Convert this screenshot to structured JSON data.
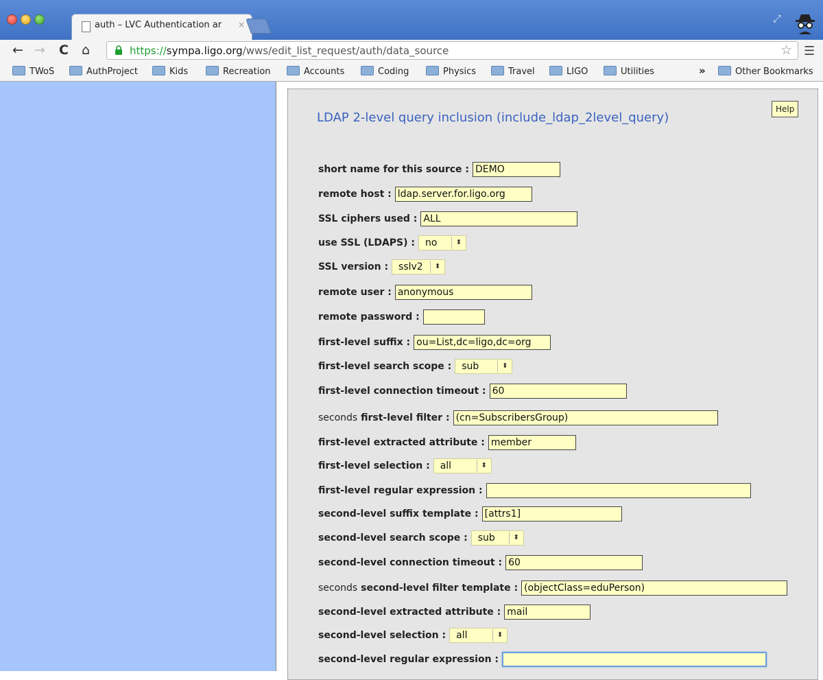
{
  "browser": {
    "tab_title": "auth – LVC Authentication ar",
    "tab_close": "×",
    "url_scheme": "https://",
    "url_host": "sympa.ligo.org",
    "url_path": "/wws/edit_list_request/auth/data_source",
    "nav": {
      "back": "←",
      "forward": "→",
      "reload": "C",
      "home": "⌂",
      "menu": "☰",
      "star": "☆"
    }
  },
  "bookmarks": {
    "items": [
      "TWoS",
      "AuthProject",
      "Kids",
      "Recreation",
      "Accounts",
      "Coding",
      "Physics",
      "Travel",
      "LIGO",
      "Utilities"
    ],
    "more": "»",
    "other": "Other Bookmarks"
  },
  "form": {
    "help": "Help",
    "title": "LDAP 2-level query inclusion (include_ldap_2level_query)",
    "fields": [
      {
        "label": "short name for this source :",
        "value": "DEMO",
        "type": "text"
      },
      {
        "label": "remote host :",
        "value": "ldap.server.for.ligo.org",
        "type": "text"
      },
      {
        "label": "SSL ciphers used :",
        "value": "ALL",
        "type": "text"
      },
      {
        "label": "use SSL (LDAPS) :",
        "value": "no",
        "type": "select"
      },
      {
        "label": "SSL version :",
        "value": "sslv2",
        "type": "select"
      },
      {
        "label": "remote user :",
        "value": "anonymous",
        "type": "text"
      },
      {
        "label": "remote password :",
        "value": "",
        "type": "text"
      },
      {
        "label": "first-level suffix :",
        "value": "ou=List,dc=ligo,dc=org",
        "type": "text"
      },
      {
        "label": "first-level search scope :",
        "value": "sub",
        "type": "select"
      },
      {
        "label": "first-level connection timeout :",
        "value": "60",
        "type": "text"
      },
      {
        "prefix": "seconds",
        "label": "first-level filter :",
        "value": "(cn=SubscribersGroup)",
        "type": "text"
      },
      {
        "label": "first-level extracted attribute :",
        "value": "member",
        "type": "text"
      },
      {
        "label": "first-level selection :",
        "value": "all",
        "type": "select"
      },
      {
        "label": "first-level regular expression :",
        "value": "",
        "type": "text"
      },
      {
        "label": "second-level suffix template :",
        "value": "[attrs1]",
        "type": "text"
      },
      {
        "label": "second-level search scope :",
        "value": "sub",
        "type": "select"
      },
      {
        "label": "second-level connection timeout :",
        "value": "60",
        "type": "text"
      },
      {
        "prefix": "seconds",
        "label": "second-level filter template :",
        "value": "(objectClass=eduPerson)",
        "type": "text"
      },
      {
        "label": "second-level extracted attribute :",
        "value": "mail",
        "type": "text"
      },
      {
        "label": "second-level selection :",
        "value": "all",
        "type": "select"
      },
      {
        "label": "second-level regular expression :",
        "value": "",
        "type": "text",
        "focused": true
      }
    ]
  }
}
